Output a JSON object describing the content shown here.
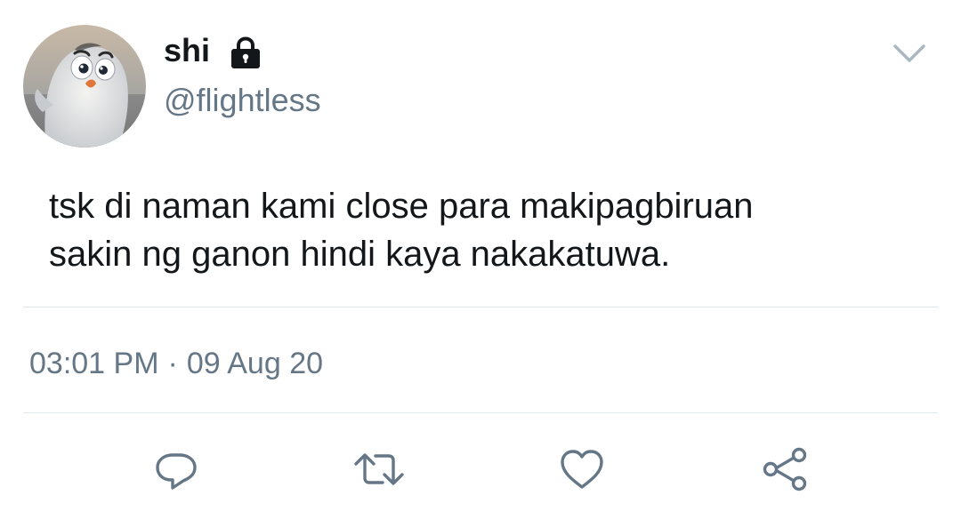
{
  "tweet": {
    "display_name": "shi",
    "handle": "@flightless",
    "text": "tsk di naman kami close para makipagbiruan\nsakin ng ganon hindi kaya nakakatuwa.",
    "time": "03:01 PM",
    "separator": "·",
    "date": "09 Aug 20"
  },
  "icons": {
    "protected": "lock-icon",
    "menu": "chevron-down-icon",
    "reply": "reply-icon",
    "retweet": "retweet-icon",
    "like": "heart-icon",
    "share": "share-icon"
  },
  "colors": {
    "text_primary": "#14171a",
    "text_secondary": "#657786",
    "divider": "#e1e8ed",
    "icon": "#657786",
    "caret": "#aab8c2"
  }
}
